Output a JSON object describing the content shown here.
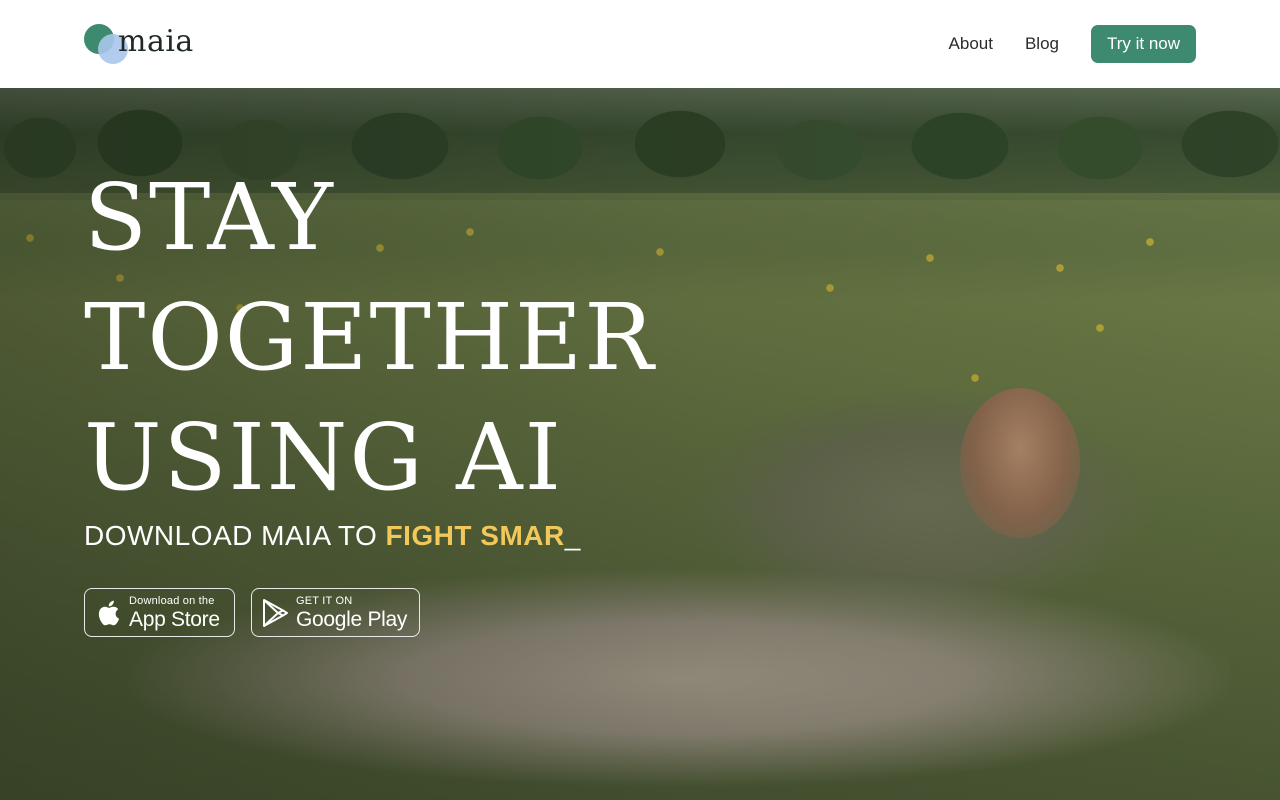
{
  "header": {
    "logo_text": "maia",
    "nav": {
      "about": "About",
      "blog": "Blog",
      "cta": "Try it now"
    }
  },
  "hero": {
    "headline": {
      "line1": "STAY",
      "line2": "TOGETHER",
      "line3": "USING AI"
    },
    "subline": {
      "prefix": "DOWNLOAD MAIA TO ",
      "typed": "FIGHT SMAR",
      "cursor": "_"
    },
    "app_store": {
      "small": "Download on the",
      "large": "App Store",
      "icon": "apple-icon"
    },
    "google_play": {
      "small": "GET IT ON",
      "large": "Google Play",
      "icon": "google-play-icon"
    }
  },
  "colors": {
    "brand_green": "#3e8a70",
    "logo_blue": "#a9c7ea",
    "highlight": "#f3c85a"
  }
}
